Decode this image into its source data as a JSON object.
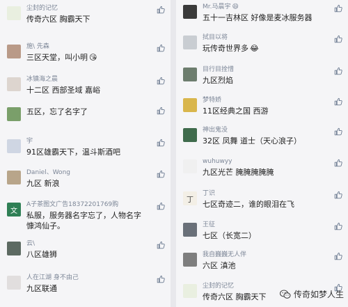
{
  "colors": {
    "panel": "#f5f5f7",
    "divider": "#e8e8ec",
    "name": "#7b8596",
    "text": "#222222",
    "like": "#6b7a90"
  },
  "left": [
    {
      "name": "尘封的记忆",
      "text": "传奇六区 胸霸天下",
      "avatar_glyph": "",
      "avatar_bg": "#e9efe0",
      "avatar_fg": "#6a8f3c"
    },
    {
      "name": "施\\ 先森",
      "text": "三区天堂，叫小明",
      "emoji": "😘",
      "avatar_glyph": "",
      "avatar_bg": "#b99a88",
      "avatar_fg": "#fff"
    },
    {
      "name": "冰镇海之晨",
      "text": "十二区 西部圣域 嘉峪",
      "avatar_glyph": "",
      "avatar_bg": "#ddd5cf",
      "avatar_fg": "#555"
    },
    {
      "name": "",
      "text": "五区，忘了名字了",
      "avatar_glyph": "",
      "avatar_bg": "#7a9f6a",
      "avatar_fg": "#fff"
    },
    {
      "name": "宇",
      "text": "91区雄霸天下，温斗斯酒吧",
      "avatar_glyph": "",
      "avatar_bg": "#cfd6e3",
      "avatar_fg": "#445"
    },
    {
      "name": "Daniel、Wong",
      "text": "九区 新浪",
      "avatar_glyph": "",
      "avatar_bg": "#b8a58a",
      "avatar_fg": "#fff"
    },
    {
      "name": "A子茶图文广告18372201769购",
      "text": "私服，服务器名字忘了，人物名字慷鸿仙子。",
      "avatar_glyph": "文",
      "avatar_bg": "#2f7f55",
      "avatar_fg": "#fff"
    },
    {
      "name": "云\\",
      "text": "八区雄狮",
      "avatar_glyph": "",
      "avatar_bg": "#5d6a62",
      "avatar_fg": "#fff"
    },
    {
      "name": "人在江湖 身不由己",
      "text": "九区联通",
      "avatar_glyph": "",
      "avatar_bg": "#e1dede",
      "avatar_fg": "#c33"
    }
  ],
  "right": [
    {
      "name": "Mr.马晨宇",
      "emoji_name": "😄",
      "text": "五十一吉林区 好像是麦冰服务器",
      "avatar_glyph": "",
      "avatar_bg": "#3a3a3a",
      "avatar_fg": "#fff"
    },
    {
      "name": "拭目以将",
      "text": "玩传奇世界多",
      "emoji": "😂",
      "avatar_glyph": "",
      "avatar_bg": "#c9cdd2",
      "avatar_fg": "#444"
    },
    {
      "name": "目行目拴惜",
      "text": "九区烈焰",
      "avatar_glyph": "",
      "avatar_bg": "#6d7d6e",
      "avatar_fg": "#fff"
    },
    {
      "name": "梦特娇",
      "text": "11区经典之国 西游",
      "avatar_glyph": "",
      "avatar_bg": "#d9b64c",
      "avatar_fg": "#fff"
    },
    {
      "name": "神出鬼没",
      "text": "32区 凤舞  道士（天心浪子）",
      "avatar_glyph": "",
      "avatar_bg": "#3f6b4c",
      "avatar_fg": "#fff"
    },
    {
      "name": "wuhuwyy",
      "text": "九区光芒 腌腌腌腌腌",
      "avatar_glyph": "",
      "avatar_bg": "#f0f0f0",
      "avatar_fg": "#c22"
    },
    {
      "name": "丁识",
      "text": "七区奇迹二，谁的眼泪在飞",
      "avatar_glyph": "丁",
      "avatar_bg": "#f3efe6",
      "avatar_fg": "#444"
    },
    {
      "name": "王征",
      "text": "七区（长宽二）",
      "avatar_glyph": "",
      "avatar_bg": "#6a7079",
      "avatar_fg": "#fff"
    },
    {
      "name": "我自巍巍无人伴",
      "text": "六区 滇池",
      "avatar_glyph": "",
      "avatar_bg": "#7e7e7e",
      "avatar_fg": "#fff"
    },
    {
      "name": "尘封的记忆",
      "text": "传奇六区 胸霸天下",
      "avatar_glyph": "",
      "avatar_bg": "#e9efe0",
      "avatar_fg": "#6a8f3c"
    }
  ],
  "watermark": {
    "text": "传奇如梦人生",
    "icon": "wechat-icon"
  },
  "icons": {
    "like": "thumbs-up-icon"
  }
}
